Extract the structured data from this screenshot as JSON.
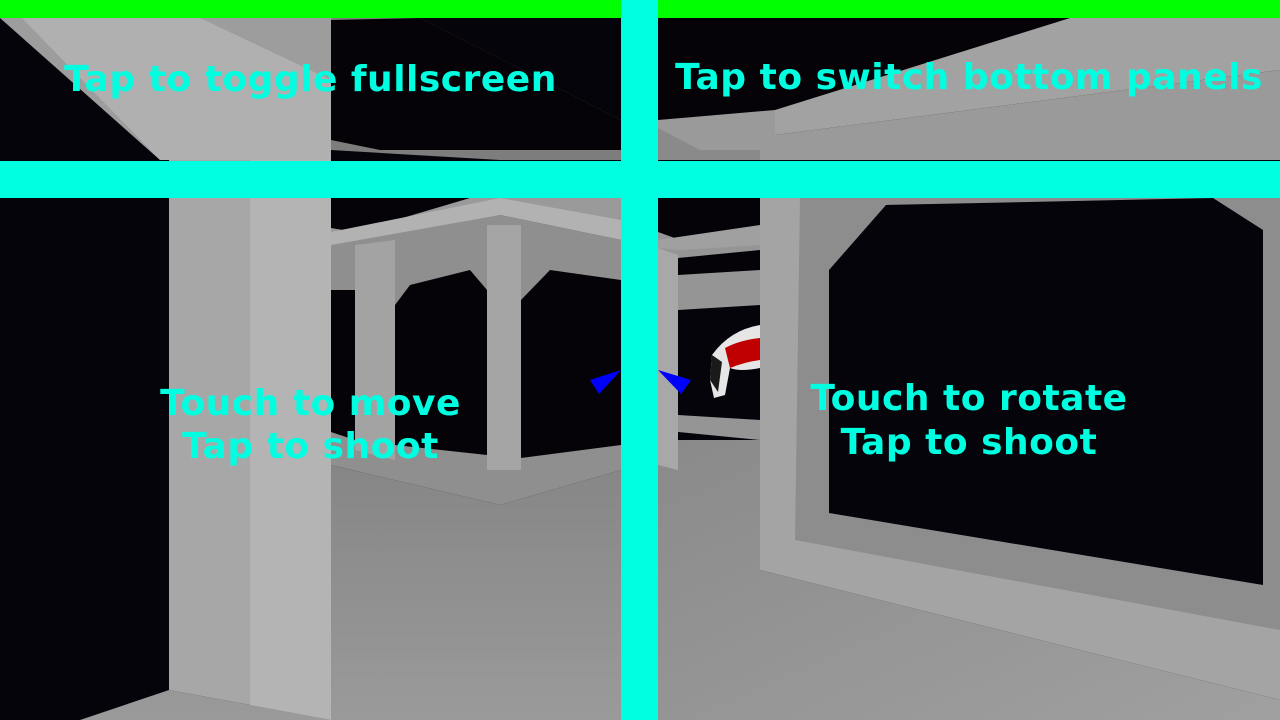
{
  "hud": {
    "top_left_label": "Tap to toggle fullscreen",
    "top_right_label": "Tap to switch bottom panels",
    "bottom_left_line1": "Touch to move",
    "bottom_left_line2": "Tap to shoot",
    "bottom_right_line1": "Touch to rotate",
    "bottom_right_line2": "Tap to shoot"
  },
  "colors": {
    "divider": "#00ffe0",
    "top_bar": "#00ff00",
    "label": "#00ffe0",
    "crosshair": "#0000ff",
    "wall_light": "#a8a8a8",
    "wall_mid": "#8c8c8c",
    "void": "#06040b",
    "enemy_accent": "#c00000"
  },
  "icons": {
    "crosshair": "crosshair-icon"
  }
}
